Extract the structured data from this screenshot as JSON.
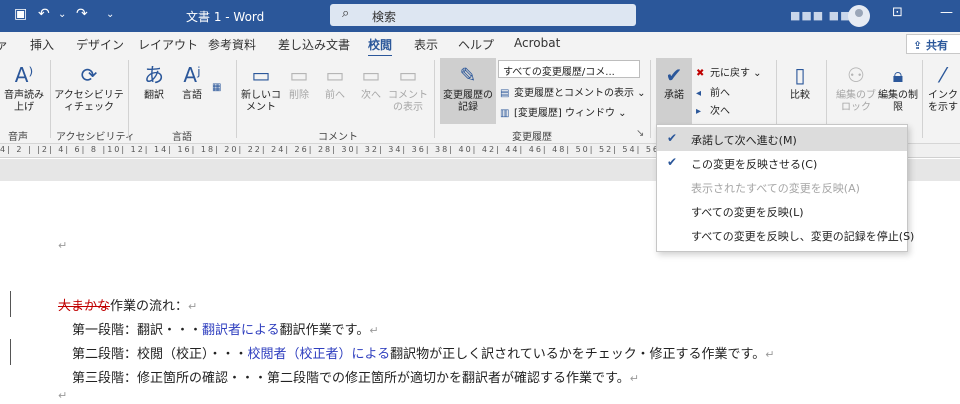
{
  "titlebar": {
    "doc_title": "文書 1  -  Word",
    "search_placeholder": "検索",
    "account_name": "■■■ ■■"
  },
  "tabs": [
    "ァ",
    "挿入",
    "デザイン",
    "レイアウト",
    "参考資料",
    "差し込み文書",
    "校閲",
    "表示",
    "ヘルプ",
    "Acrobat"
  ],
  "active_tab": "校閲",
  "share_label": "共有",
  "ribbon": {
    "read_aloud": "音声読み上げ",
    "accessibility_check": "アクセシビリティチェック",
    "translate": "翻訳",
    "language": "言語",
    "new_comment": "新しいコメント",
    "delete": "削除",
    "previous": "前へ",
    "next": "次へ",
    "show_comments": "コメントの表示",
    "track_changes": "変更履歴の記録",
    "markup_dropdown": "すべての変更履歴/コメ...",
    "show_markup": "変更履歴とコメントの表示",
    "reviewing_pane": "[変更履歴] ウィンドウ",
    "accept": "承諾",
    "reject": "元に戻す",
    "prev_change": "前へ",
    "next_change": "次へ",
    "compare": "比較",
    "block_authors": "編集のブロック",
    "restrict_editing": "編集の制限",
    "hide_ink": "インクを示す",
    "groups": {
      "speech": "音声",
      "accessibility": "アクセシビリティ",
      "language": "言語",
      "comments": "コメント",
      "tracking": "変更履歴"
    }
  },
  "ruler_text": "4| 2 | |2| 4| 6| 8 |10| 12| 14| 16| 18| 20| 22| 24| 26| 28| 30| 32| 34| 36| 38| 40| 42| 44| 46| 48| 50| 52| 54| 56| 58| 60| 62|64",
  "document": {
    "line1_deleted": "大まかな",
    "line1_rest": "作業の流れ：",
    "line2_a": "第一段階：翻訳・・・",
    "line2_ins": "翻訳者による",
    "line2_b": "翻訳作業です。",
    "line3_a": "第二段階：校閲（校正）・・・",
    "line3_ins": "校閲者（校正者）による",
    "line3_b": "翻訳物が正しく訳されているかをチェック・修正する作業です。",
    "line4": "第三段階：修正箇所の確認・・・第二段階での修正箇所が適切かを翻訳者が確認する作業です。",
    "para_mark": "↵"
  },
  "accept_menu": [
    {
      "label": "承諾して次へ進む(M)",
      "highlighted": true,
      "disabled": false,
      "icon": "accept-next-icon"
    },
    {
      "label": "この変更を反映させる(C)",
      "highlighted": false,
      "disabled": false,
      "icon": "accept-change-icon"
    },
    {
      "label": "表示されたすべての変更を反映(A)",
      "highlighted": false,
      "disabled": true,
      "icon": ""
    },
    {
      "label": "すべての変更を反映(L)",
      "highlighted": false,
      "disabled": false,
      "icon": ""
    },
    {
      "label": "すべての変更を反映し、変更の記録を停止(S)",
      "highlighted": false,
      "disabled": false,
      "icon": ""
    }
  ]
}
